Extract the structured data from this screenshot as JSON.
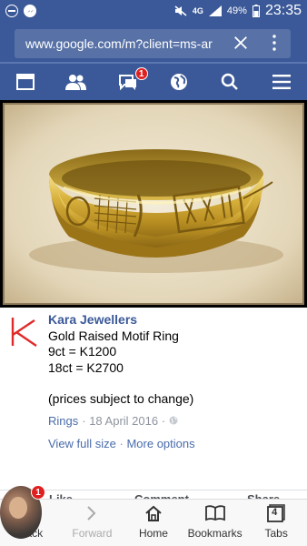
{
  "status_bar": {
    "network": "4G",
    "battery": "49%",
    "time": "23:35"
  },
  "browser": {
    "url": "www.google.com/m?client=ms-ar"
  },
  "fb_nav": {
    "messages_badge": "1"
  },
  "post": {
    "page_name": "Kara Jewellers",
    "lines": [
      "Gold Raised Motif Ring",
      "9ct = K1200",
      "18ct = K2700",
      "(prices subject to change)"
    ],
    "album_link": "Rings",
    "date": "· 18 April 2016 ·",
    "view_full_size": "View full size",
    "separator": " · ",
    "more_options": "More options"
  },
  "reactions": {
    "like": "Like",
    "comment": "Comment",
    "share": "Share"
  },
  "toolbar": {
    "back": "Back",
    "forward": "Forward",
    "home": "Home",
    "bookmarks": "Bookmarks",
    "tabs": "Tabs",
    "tabs_count": "4"
  },
  "chat_head": {
    "badge": "1"
  },
  "colors": {
    "facebook_blue": "#3b5998",
    "link_blue": "#4a6cab",
    "badge_red": "#e02020",
    "logo_red": "#e02a2a"
  }
}
